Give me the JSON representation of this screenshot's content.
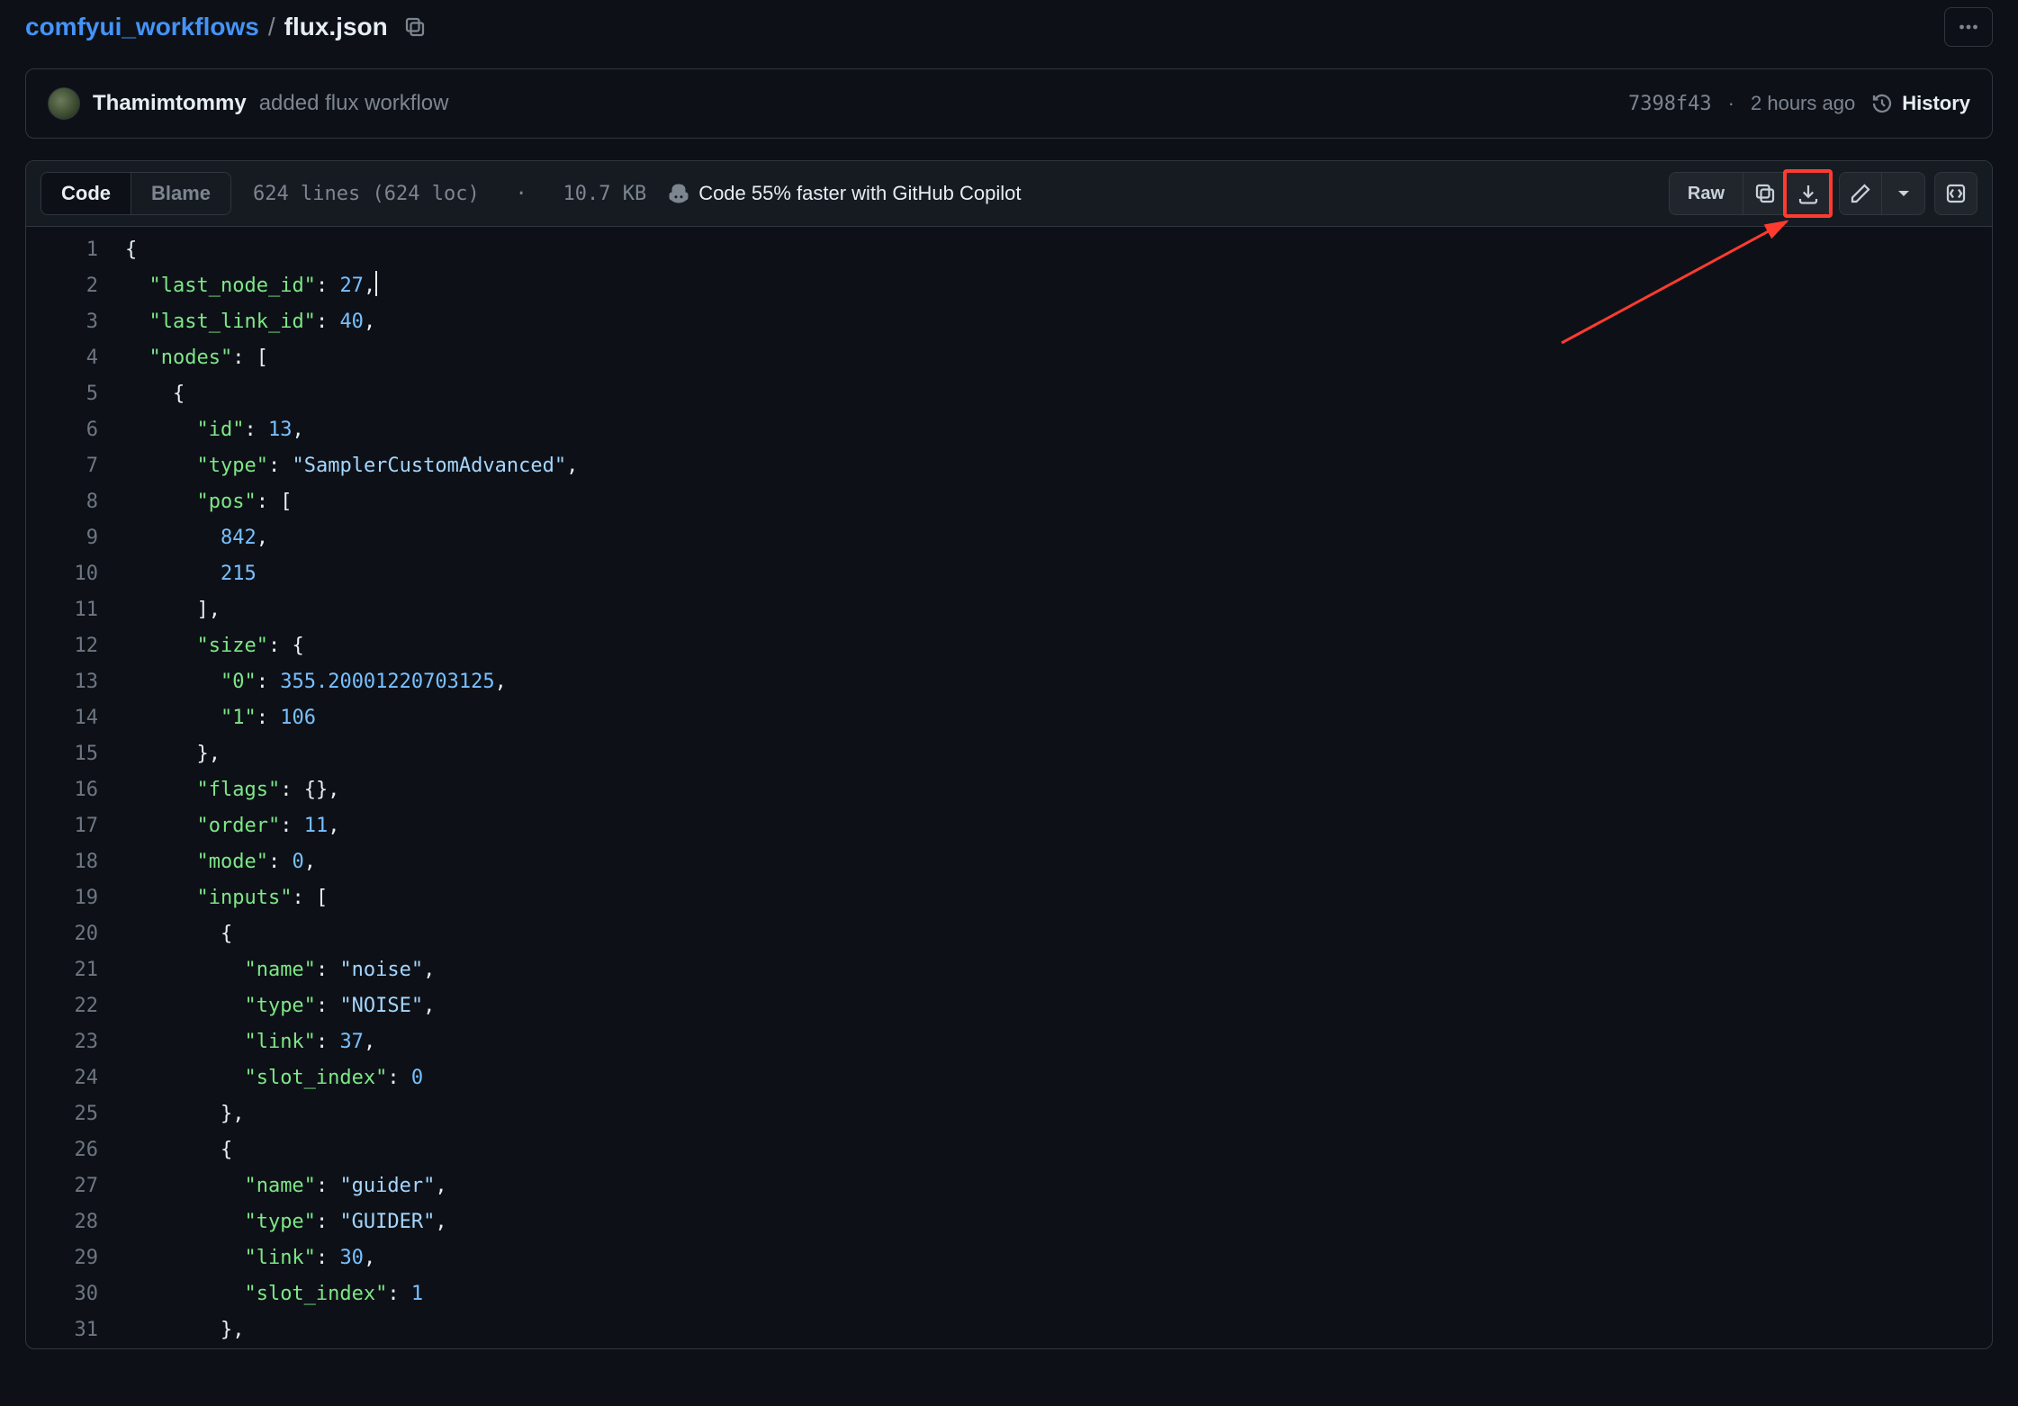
{
  "breadcrumb": {
    "parent": "comfyui_workflows",
    "sep": "/",
    "current": "flux.json"
  },
  "commit": {
    "author": "Thamimtommy",
    "message": "added flux workflow",
    "hash": "7398f43",
    "time": "2 hours ago",
    "history_label": "History"
  },
  "toolbar": {
    "code_tab": "Code",
    "blame_tab": "Blame",
    "meta_lines": "624 lines (624 loc)",
    "meta_sep": "·",
    "meta_size": "10.7 KB",
    "copilot_text": "Code 55% faster with GitHub Copilot",
    "raw_label": "Raw"
  },
  "code": {
    "lines": [
      {
        "n": 1,
        "tokens": [
          [
            "punc",
            "{"
          ]
        ]
      },
      {
        "n": 2,
        "tokens": [
          [
            "ind",
            "  "
          ],
          [
            "key",
            "\"last_node_id\""
          ],
          [
            "punc",
            ": "
          ],
          [
            "num",
            "27"
          ],
          [
            "punc",
            ","
          ],
          [
            "cursor",
            ""
          ]
        ]
      },
      {
        "n": 3,
        "tokens": [
          [
            "ind",
            "  "
          ],
          [
            "key",
            "\"last_link_id\""
          ],
          [
            "punc",
            ": "
          ],
          [
            "num",
            "40"
          ],
          [
            "punc",
            ","
          ]
        ]
      },
      {
        "n": 4,
        "tokens": [
          [
            "ind",
            "  "
          ],
          [
            "key",
            "\"nodes\""
          ],
          [
            "punc",
            ": ["
          ]
        ]
      },
      {
        "n": 5,
        "tokens": [
          [
            "ind",
            "    "
          ],
          [
            "punc",
            "{"
          ]
        ]
      },
      {
        "n": 6,
        "tokens": [
          [
            "ind",
            "      "
          ],
          [
            "key",
            "\"id\""
          ],
          [
            "punc",
            ": "
          ],
          [
            "num",
            "13"
          ],
          [
            "punc",
            ","
          ]
        ]
      },
      {
        "n": 7,
        "tokens": [
          [
            "ind",
            "      "
          ],
          [
            "key",
            "\"type\""
          ],
          [
            "punc",
            ": "
          ],
          [
            "str",
            "\"SamplerCustomAdvanced\""
          ],
          [
            "punc",
            ","
          ]
        ]
      },
      {
        "n": 8,
        "tokens": [
          [
            "ind",
            "      "
          ],
          [
            "key",
            "\"pos\""
          ],
          [
            "punc",
            ": ["
          ]
        ]
      },
      {
        "n": 9,
        "tokens": [
          [
            "ind",
            "        "
          ],
          [
            "num",
            "842"
          ],
          [
            "punc",
            ","
          ]
        ]
      },
      {
        "n": 10,
        "tokens": [
          [
            "ind",
            "        "
          ],
          [
            "num",
            "215"
          ]
        ]
      },
      {
        "n": 11,
        "tokens": [
          [
            "ind",
            "      "
          ],
          [
            "punc",
            "],"
          ]
        ]
      },
      {
        "n": 12,
        "tokens": [
          [
            "ind",
            "      "
          ],
          [
            "key",
            "\"size\""
          ],
          [
            "punc",
            ": {"
          ]
        ]
      },
      {
        "n": 13,
        "tokens": [
          [
            "ind",
            "        "
          ],
          [
            "key",
            "\"0\""
          ],
          [
            "punc",
            ": "
          ],
          [
            "num",
            "355.20001220703125"
          ],
          [
            "punc",
            ","
          ]
        ]
      },
      {
        "n": 14,
        "tokens": [
          [
            "ind",
            "        "
          ],
          [
            "key",
            "\"1\""
          ],
          [
            "punc",
            ": "
          ],
          [
            "num",
            "106"
          ]
        ]
      },
      {
        "n": 15,
        "tokens": [
          [
            "ind",
            "      "
          ],
          [
            "punc",
            "},"
          ]
        ]
      },
      {
        "n": 16,
        "tokens": [
          [
            "ind",
            "      "
          ],
          [
            "key",
            "\"flags\""
          ],
          [
            "punc",
            ": {},"
          ]
        ]
      },
      {
        "n": 17,
        "tokens": [
          [
            "ind",
            "      "
          ],
          [
            "key",
            "\"order\""
          ],
          [
            "punc",
            ": "
          ],
          [
            "num",
            "11"
          ],
          [
            "punc",
            ","
          ]
        ]
      },
      {
        "n": 18,
        "tokens": [
          [
            "ind",
            "      "
          ],
          [
            "key",
            "\"mode\""
          ],
          [
            "punc",
            ": "
          ],
          [
            "num",
            "0"
          ],
          [
            "punc",
            ","
          ]
        ]
      },
      {
        "n": 19,
        "tokens": [
          [
            "ind",
            "      "
          ],
          [
            "key",
            "\"inputs\""
          ],
          [
            "punc",
            ": ["
          ]
        ]
      },
      {
        "n": 20,
        "tokens": [
          [
            "ind",
            "        "
          ],
          [
            "punc",
            "{"
          ]
        ]
      },
      {
        "n": 21,
        "tokens": [
          [
            "ind",
            "          "
          ],
          [
            "key",
            "\"name\""
          ],
          [
            "punc",
            ": "
          ],
          [
            "str",
            "\"noise\""
          ],
          [
            "punc",
            ","
          ]
        ]
      },
      {
        "n": 22,
        "tokens": [
          [
            "ind",
            "          "
          ],
          [
            "key",
            "\"type\""
          ],
          [
            "punc",
            ": "
          ],
          [
            "str",
            "\"NOISE\""
          ],
          [
            "punc",
            ","
          ]
        ]
      },
      {
        "n": 23,
        "tokens": [
          [
            "ind",
            "          "
          ],
          [
            "key",
            "\"link\""
          ],
          [
            "punc",
            ": "
          ],
          [
            "num",
            "37"
          ],
          [
            "punc",
            ","
          ]
        ]
      },
      {
        "n": 24,
        "tokens": [
          [
            "ind",
            "          "
          ],
          [
            "key",
            "\"slot_index\""
          ],
          [
            "punc",
            ": "
          ],
          [
            "num",
            "0"
          ]
        ]
      },
      {
        "n": 25,
        "tokens": [
          [
            "ind",
            "        "
          ],
          [
            "punc",
            "},"
          ]
        ]
      },
      {
        "n": 26,
        "tokens": [
          [
            "ind",
            "        "
          ],
          [
            "punc",
            "{"
          ]
        ]
      },
      {
        "n": 27,
        "tokens": [
          [
            "ind",
            "          "
          ],
          [
            "key",
            "\"name\""
          ],
          [
            "punc",
            ": "
          ],
          [
            "str",
            "\"guider\""
          ],
          [
            "punc",
            ","
          ]
        ]
      },
      {
        "n": 28,
        "tokens": [
          [
            "ind",
            "          "
          ],
          [
            "key",
            "\"type\""
          ],
          [
            "punc",
            ": "
          ],
          [
            "str",
            "\"GUIDER\""
          ],
          [
            "punc",
            ","
          ]
        ]
      },
      {
        "n": 29,
        "tokens": [
          [
            "ind",
            "          "
          ],
          [
            "key",
            "\"link\""
          ],
          [
            "punc",
            ": "
          ],
          [
            "num",
            "30"
          ],
          [
            "punc",
            ","
          ]
        ]
      },
      {
        "n": 30,
        "tokens": [
          [
            "ind",
            "          "
          ],
          [
            "key",
            "\"slot_index\""
          ],
          [
            "punc",
            ": "
          ],
          [
            "num",
            "1"
          ]
        ]
      },
      {
        "n": 31,
        "tokens": [
          [
            "ind",
            "        "
          ],
          [
            "punc",
            "},"
          ]
        ]
      }
    ]
  }
}
